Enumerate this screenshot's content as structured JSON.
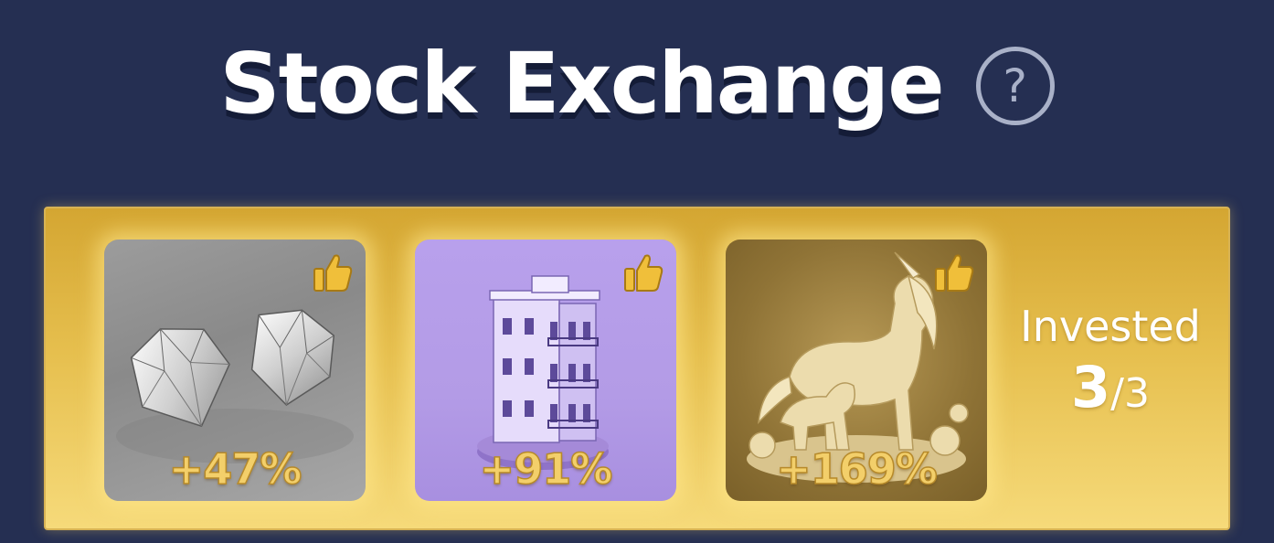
{
  "header": {
    "title": "Stock Exchange",
    "help_icon": "question-circle-icon",
    "help_glyph": "?"
  },
  "investments": [
    {
      "name": "diamonds",
      "change": "+47%",
      "liked": true,
      "icon": "thumbs-up-icon",
      "color": "#9a9a9a"
    },
    {
      "name": "building",
      "change": "+91%",
      "liked": true,
      "icon": "thumbs-up-icon",
      "color": "#b59ce8"
    },
    {
      "name": "unicorn",
      "change": "+169%",
      "liked": true,
      "icon": "thumbs-up-icon",
      "color": "#9a7c3e"
    }
  ],
  "invested": {
    "label": "Invested",
    "count": "3",
    "separator": "/",
    "total": "3"
  },
  "colors": {
    "background": "#252f52",
    "panel_gold": "#e6bf4e",
    "percent_gold": "#f3cf6a",
    "thumb_gold": "#f0bf3a"
  }
}
